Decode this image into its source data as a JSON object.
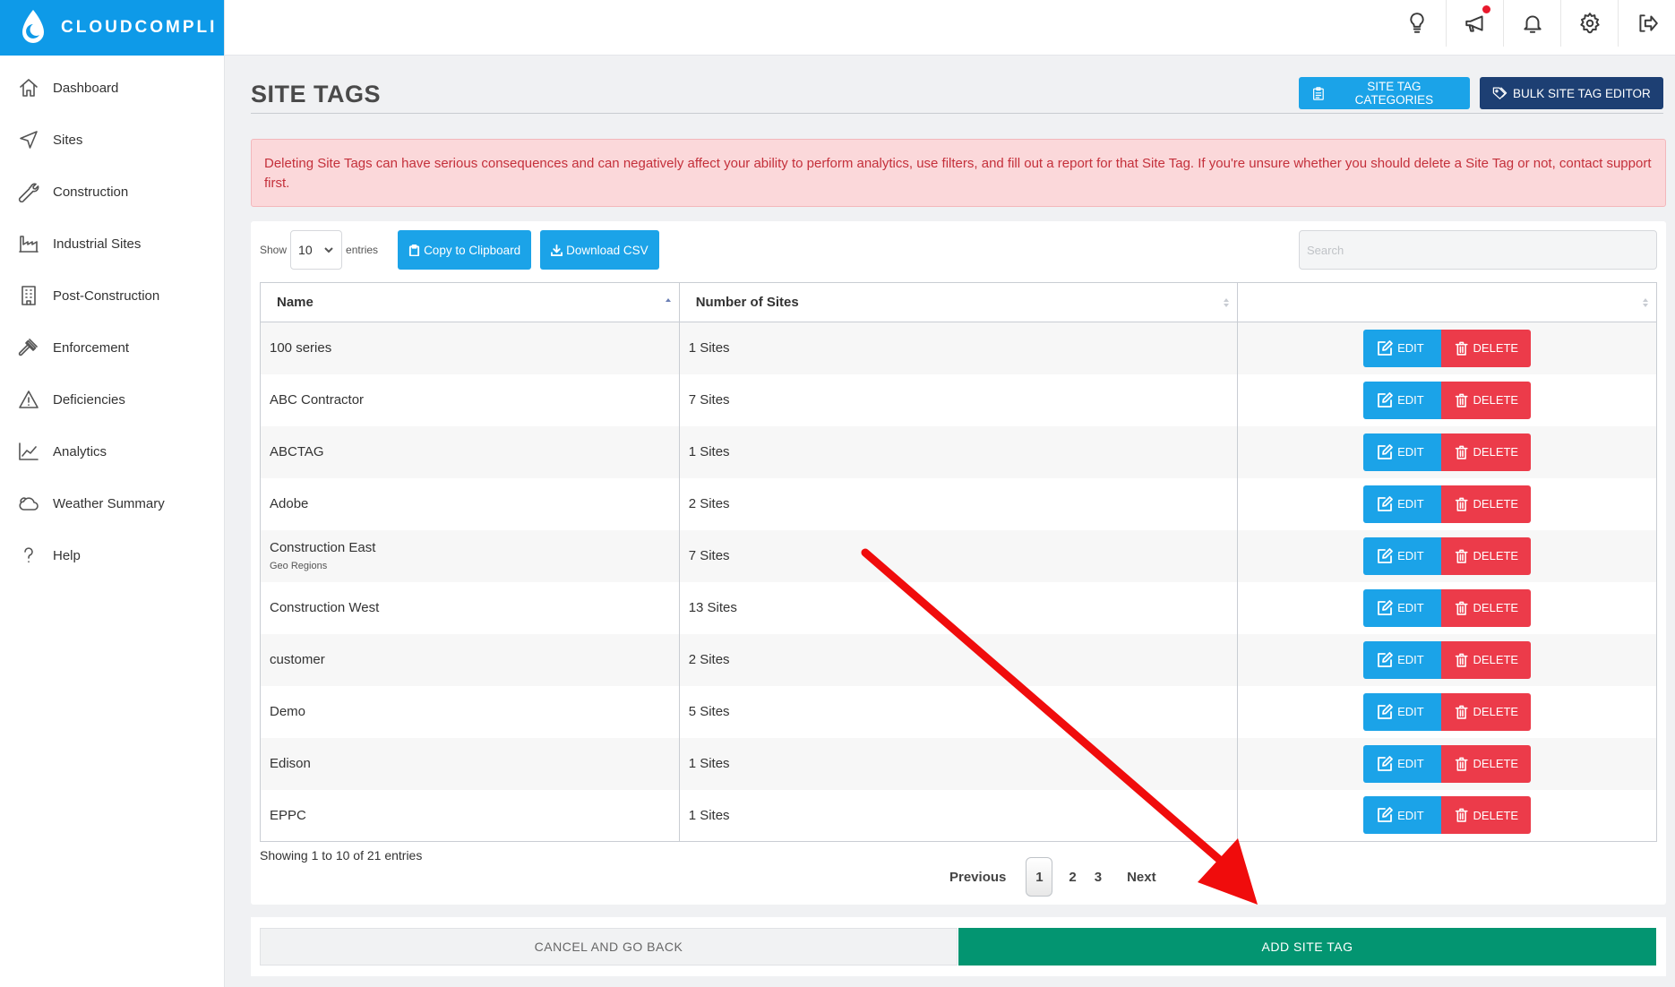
{
  "brand": {
    "name": "CLOUDCOMPLI",
    "color": "#0e9ae8"
  },
  "sidebar": {
    "items": [
      {
        "label": "Dashboard",
        "icon": "home-icon"
      },
      {
        "label": "Sites",
        "icon": "navigation-icon"
      },
      {
        "label": "Construction",
        "icon": "wrench-icon"
      },
      {
        "label": "Industrial Sites",
        "icon": "factory-icon"
      },
      {
        "label": "Post-Construction",
        "icon": "building-icon"
      },
      {
        "label": "Enforcement",
        "icon": "gavel-icon"
      },
      {
        "label": "Deficiencies",
        "icon": "warning-icon"
      },
      {
        "label": "Analytics",
        "icon": "line-chart-icon"
      },
      {
        "label": "Weather Summary",
        "icon": "cloud-icon"
      },
      {
        "label": "Help",
        "icon": "question-icon"
      }
    ]
  },
  "topbar": {
    "icons": [
      "lightbulb-icon",
      "megaphone-icon",
      "bell-icon",
      "gear-icon",
      "logout-icon"
    ]
  },
  "page": {
    "title": "SITE TAGS",
    "categories_button": "SITE TAG CATEGORIES",
    "bulk_button": "BULK SITE TAG EDITOR",
    "alert": "Deleting Site Tags can have serious consequences and can negatively affect your ability to perform analytics, use filters, and fill out a report for that Site Tag. If you're unsure whether you should delete a Site Tag or not, contact support first."
  },
  "controls": {
    "show_label": "Show",
    "entries_value": "10",
    "entries_label": "entries",
    "copy_button": "Copy to Clipboard",
    "download_button": "Download CSV",
    "search_placeholder": "Search"
  },
  "table": {
    "columns": [
      "Name",
      "Number of Sites",
      ""
    ],
    "rows": [
      {
        "name": "100 series",
        "category": "",
        "sites": "1 Sites"
      },
      {
        "name": "ABC Contractor",
        "category": "",
        "sites": "7 Sites"
      },
      {
        "name": "ABCTAG",
        "category": "",
        "sites": "1 Sites"
      },
      {
        "name": "Adobe",
        "category": "",
        "sites": "2 Sites"
      },
      {
        "name": "Construction East",
        "category": "Geo Regions",
        "sites": "7 Sites"
      },
      {
        "name": "Construction West",
        "category": "",
        "sites": "13 Sites"
      },
      {
        "name": "customer",
        "category": "",
        "sites": "2 Sites"
      },
      {
        "name": "Demo",
        "category": "",
        "sites": "5 Sites"
      },
      {
        "name": "Edison",
        "category": "",
        "sites": "1 Sites"
      },
      {
        "name": "EPPC",
        "category": "",
        "sites": "1 Sites"
      }
    ],
    "edit_label": "EDIT",
    "delete_label": "DELETE"
  },
  "pagination": {
    "info": "Showing 1 to 10 of 21 entries",
    "previous": "Previous",
    "pages": [
      "1",
      "2",
      "3"
    ],
    "current": "1",
    "next": "Next"
  },
  "footer": {
    "cancel": "CANCEL AND GO BACK",
    "add": "ADD SITE TAG"
  },
  "colors": {
    "primary": "#1ba3e8",
    "navy": "#1d3f73",
    "danger": "#ec3b4a",
    "success": "#039571",
    "alert_bg": "#fbd8da",
    "annotation_arrow": "#f00c0c"
  }
}
